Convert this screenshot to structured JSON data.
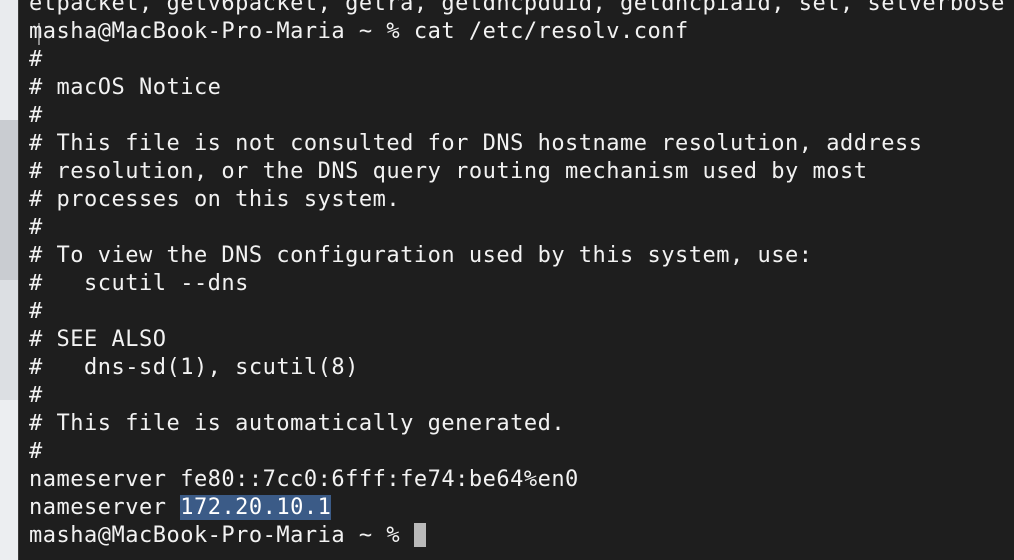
{
  "terminal": {
    "lines": [
      "etpacket, getv6packet, getra, getdhcpduid, getdhcpiaid, set, setverbose",
      "masha@MacBook-Pro-Maria ~ % cat /etc/resolv.conf",
      "#",
      "# macOS Notice",
      "#",
      "# This file is not consulted for DNS hostname resolution, address",
      "# resolution, or the DNS query routing mechanism used by most",
      "# processes on this system.",
      "#",
      "# To view the DNS configuration used by this system, use:",
      "#   scutil --dns",
      "#",
      "# SEE ALSO",
      "#   dns-sd(1), scutil(8)",
      "#",
      "# This file is automatically generated.",
      "#",
      "nameserver fe80::7cc0:6fff:fe74:be64%en0"
    ],
    "nameserver2_prefix": "nameserver ",
    "nameserver2_selected": "172.20.10.1",
    "prompt": "masha@MacBook-Pro-Maria ~ % "
  },
  "colors": {
    "background": "#1e1e1e",
    "text": "#f2f2f2",
    "selection": "#3b5b87",
    "cursor": "#b9b9b9"
  }
}
